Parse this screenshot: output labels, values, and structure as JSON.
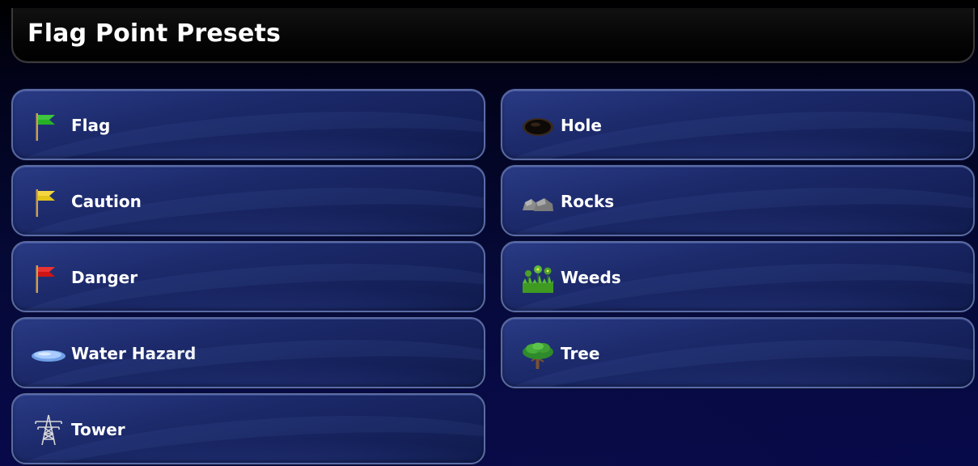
{
  "header": {
    "title": "Flag Point Presets"
  },
  "presets": {
    "left": [
      {
        "label": "Flag",
        "icon": "green-flag-icon",
        "color": "#2aa02a"
      },
      {
        "label": "Caution",
        "icon": "yellow-flag-icon",
        "color": "#e6c21a"
      },
      {
        "label": "Danger",
        "icon": "red-flag-icon",
        "color": "#d01818"
      },
      {
        "label": "Water Hazard",
        "icon": "water-puddle-icon",
        "color": "#8fb8f0"
      },
      {
        "label": "Tower",
        "icon": "power-tower-icon",
        "color": "#cccccc"
      }
    ],
    "right": [
      {
        "label": "Hole",
        "icon": "hole-icon",
        "color": "#1a1a1a"
      },
      {
        "label": "Rocks",
        "icon": "rocks-icon",
        "color": "#8a8a8a"
      },
      {
        "label": "Weeds",
        "icon": "weeds-icon",
        "color": "#3a8a2a"
      },
      {
        "label": "Tree",
        "icon": "tree-icon",
        "color": "#2f8f2f"
      }
    ]
  },
  "colors": {
    "background": "#050935",
    "button_fill": "#1c2a6b",
    "button_border": "#5a6ba6",
    "text": "#ffffff"
  }
}
